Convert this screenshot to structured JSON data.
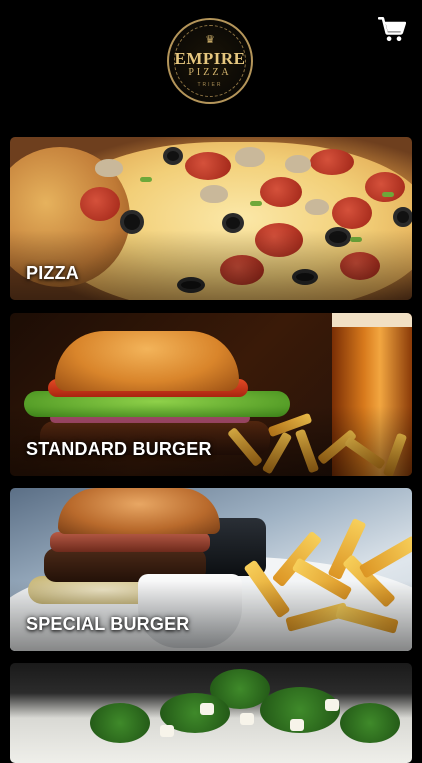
{
  "header": {
    "logo": {
      "name": "EMPIRE",
      "sub": "PIZZA",
      "place": "TRIER",
      "crown_icon": "crown-icon"
    },
    "cart_icon": "cart-icon"
  },
  "categories": [
    {
      "label": "PIZZA"
    },
    {
      "label": "STANDARD BURGER"
    },
    {
      "label": "SPECIAL BURGER"
    },
    {
      "label": ""
    }
  ],
  "colors": {
    "background": "#000000",
    "logo_gold": "#e6c77f",
    "label_text": "#ffffff"
  }
}
